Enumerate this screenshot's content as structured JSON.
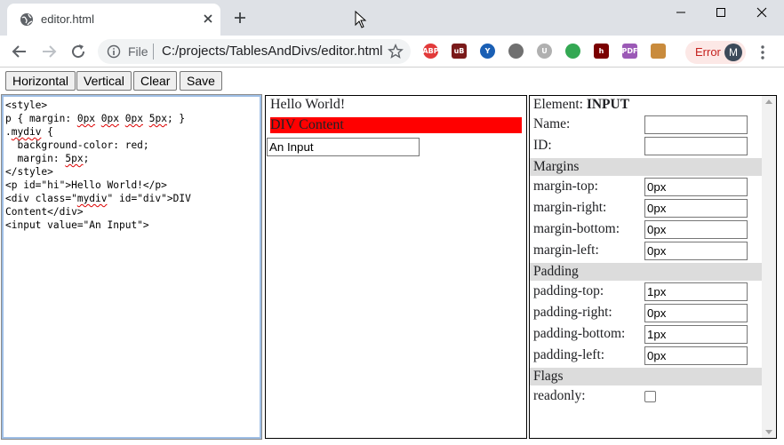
{
  "browser": {
    "tab_title": "editor.html",
    "omnibox_scheme": "File",
    "url": "C:/projects/TablesAndDivs/editor.html",
    "error_label": "Error",
    "avatar_initial": "M",
    "extensions": [
      {
        "icon": "adblock-plus-icon",
        "label": "ABP",
        "color": "#e23a3a"
      },
      {
        "icon": "ublock-icon",
        "label": "uB",
        "color": "#7a1a1a"
      },
      {
        "icon": "vpn-y-icon",
        "label": "Y",
        "color": "#1a5fb4"
      },
      {
        "icon": "circle-extension-icon",
        "label": "",
        "color": "#707070"
      },
      {
        "icon": "u-extension-icon",
        "label": "U",
        "color": "#b0b0b0"
      },
      {
        "icon": "chrome-extension-icon",
        "label": "",
        "color": "#34a853"
      },
      {
        "icon": "h-extension-icon",
        "label": "h",
        "color": "#7a0000"
      },
      {
        "icon": "pdf-extension-icon",
        "label": "PDF",
        "color": "#9b59b6"
      },
      {
        "icon": "briefcase-extension-icon",
        "label": "",
        "color": "#c98b3c"
      }
    ]
  },
  "toolbar": {
    "horizontal_label": "Horizontal",
    "vertical_label": "Vertical",
    "clear_label": "Clear",
    "save_label": "Save"
  },
  "editor": {
    "lines": [
      "<style>",
      "p { margin: 0px 0px 0px 5px; }",
      ".mydiv {",
      "  background-color: red;",
      "  margin: 5px;",
      "</style>",
      "<p id=\"hi\">Hello World!</p>",
      "<div class=\"mydiv\" id=\"div\">DIV",
      "Content</div>",
      "<input value=\"An Input\">"
    ]
  },
  "preview": {
    "paragraph": "Hello World!",
    "div_text": "DIV Content",
    "input_value": "An Input"
  },
  "properties": {
    "element_prefix": "Element:",
    "element_name": "INPUT",
    "name_label": "Name:",
    "name_value": "",
    "id_label": "ID:",
    "id_value": "",
    "margins_heading": "Margins",
    "margin_top_label": "margin-top:",
    "margin_top": "0px",
    "margin_right_label": "margin-right:",
    "margin_right": "0px",
    "margin_bottom_label": "margin-bottom:",
    "margin_bottom": "0px",
    "margin_left_label": "margin-left:",
    "margin_left": "0px",
    "padding_heading": "Padding",
    "padding_top_label": "padding-top:",
    "padding_top": "1px",
    "padding_right_label": "padding-right:",
    "padding_right": "0px",
    "padding_bottom_label": "padding-bottom:",
    "padding_bottom": "1px",
    "padding_left_label": "padding-left:",
    "padding_left": "0px",
    "flags_heading": "Flags",
    "readonly_label": "readonly:",
    "readonly_checked": false
  },
  "colors": {
    "div_background": "#ff0000",
    "section_background": "#dcdcdc",
    "error_pill": "#fce8e6"
  }
}
